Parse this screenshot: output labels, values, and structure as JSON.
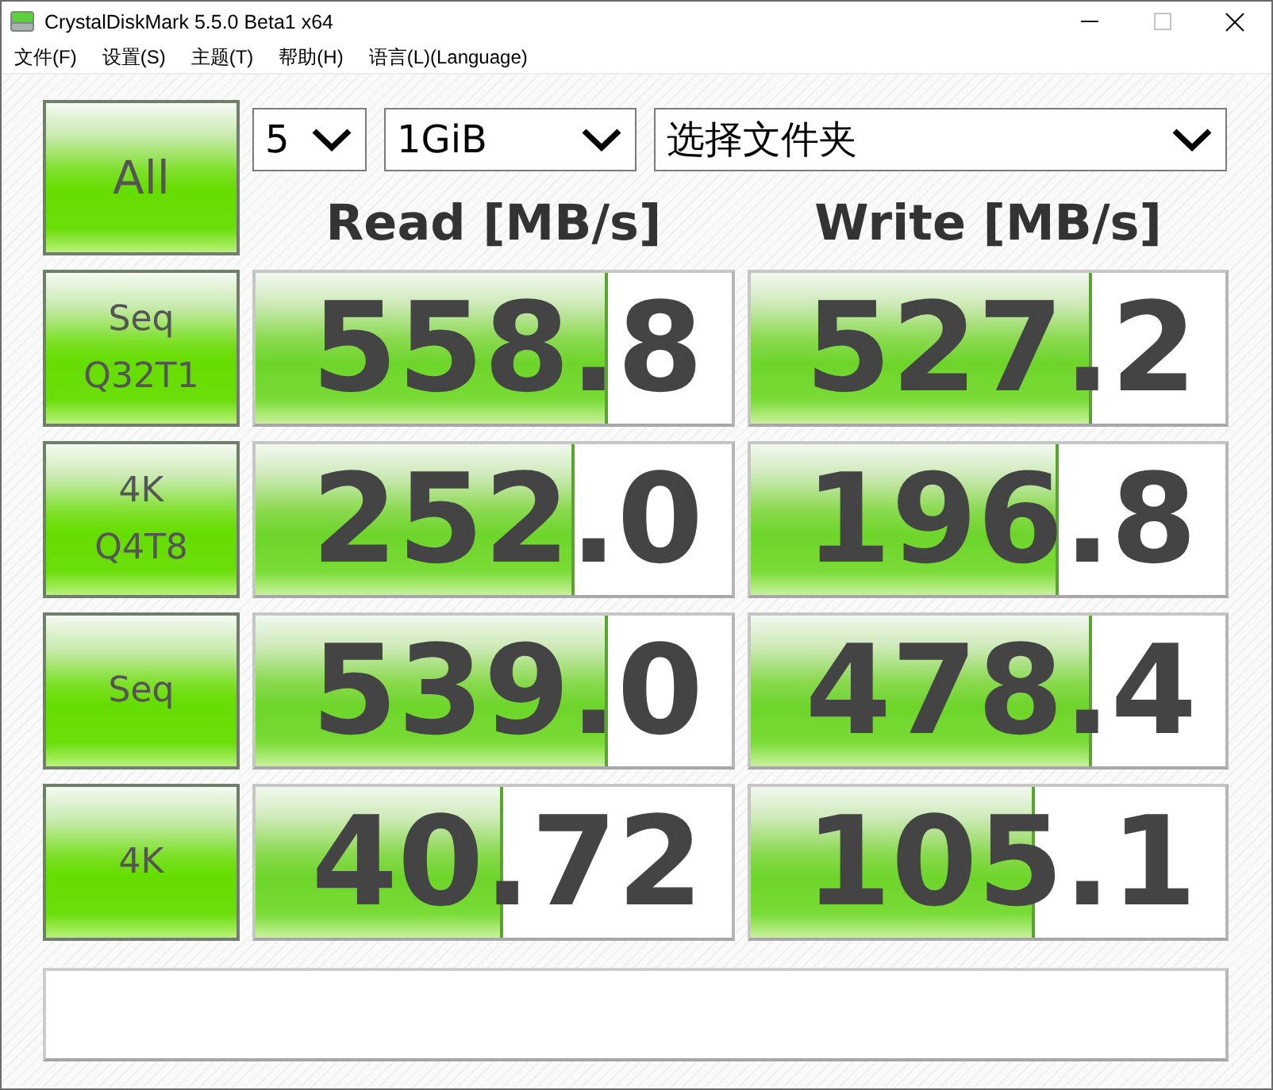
{
  "window": {
    "title": "CrystalDiskMark 5.5.0 Beta1 x64",
    "controls": [
      {
        "kind": "minimize",
        "disabled": false
      },
      {
        "kind": "maximize",
        "disabled": true
      },
      {
        "kind": "close",
        "disabled": false
      }
    ]
  },
  "menu": [
    {
      "label": "文件(F)"
    },
    {
      "label": "设置(S)"
    },
    {
      "label": "主题(T)"
    },
    {
      "label": "帮助(H)"
    },
    {
      "label": "语言(L)(Language)"
    }
  ],
  "all_button": {
    "label": "All"
  },
  "selectors": [
    {
      "value": "5"
    },
    {
      "value": "1GiB"
    },
    {
      "value": "选择文件夹"
    }
  ],
  "columns": [
    "Read [MB/s]",
    "Write [MB/s]"
  ],
  "tests": [
    {
      "label_lines": [
        "Seq",
        "Q32T1"
      ],
      "read": {
        "value": "558.8",
        "level": 0.74
      },
      "write": {
        "value": "527.2",
        "level": 0.72
      }
    },
    {
      "label_lines": [
        "4K",
        "Q4T8"
      ],
      "read": {
        "value": "252.0",
        "level": 0.67
      },
      "write": {
        "value": "196.8",
        "level": 0.65
      }
    },
    {
      "label_lines": [
        "Seq"
      ],
      "read": {
        "value": "539.0",
        "level": 0.74
      },
      "write": {
        "value": "478.4",
        "level": 0.72
      }
    },
    {
      "label_lines": [
        "4K"
      ],
      "read": {
        "value": "40.72",
        "level": 0.52
      },
      "write": {
        "value": "105.1",
        "level": 0.6
      }
    }
  ]
}
